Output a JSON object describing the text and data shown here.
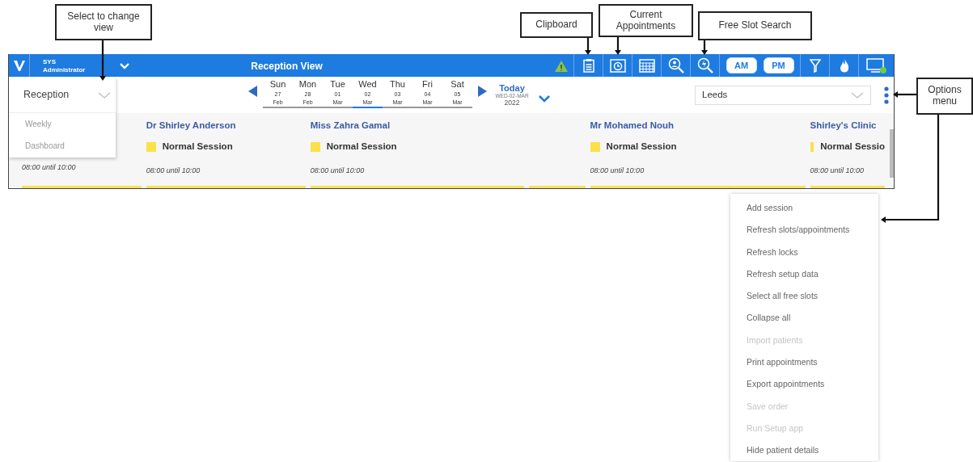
{
  "callouts": [
    {
      "text": "Select to change view"
    },
    {
      "text": "Clipboard"
    },
    {
      "text": "Current Appointments"
    },
    {
      "text": "Free Slot Search"
    },
    {
      "text": "Options menu"
    }
  ],
  "header": {
    "user": [
      "SYS",
      "Administrator"
    ],
    "title": "Reception View",
    "session_buttons": [
      {
        "label": "AM"
      },
      {
        "label": "PM"
      }
    ]
  },
  "view_select": {
    "value": "Reception",
    "options": [
      "Weekly",
      "Dashboard"
    ]
  },
  "days": [
    {
      "day": "Sun",
      "date": "27",
      "month": "Feb",
      "selected": false
    },
    {
      "day": "Mon",
      "date": "28",
      "month": "Feb",
      "selected": false
    },
    {
      "day": "Tue",
      "date": "01",
      "month": "Mar",
      "selected": false
    },
    {
      "day": "Wed",
      "date": "02",
      "month": "Mar",
      "selected": true
    },
    {
      "day": "Thu",
      "date": "03",
      "month": "Mar",
      "selected": false
    },
    {
      "day": "Fri",
      "date": "04",
      "month": "Mar",
      "selected": false
    },
    {
      "day": "Sat",
      "date": "05",
      "month": "Mar",
      "selected": false
    }
  ],
  "today": {
    "label": "Today",
    "date": "WED-02-MAR",
    "year": "2022"
  },
  "location_select": {
    "value": "Leeds"
  },
  "columns": [
    {
      "time": "08:00 until 10:00"
    },
    {
      "name": "Dr Shirley Anderson",
      "session": "Normal Session",
      "time": "08:00 until 10:00"
    },
    {
      "name": "Miss Zahra Gamal",
      "session": "Normal Session",
      "time": "08:00 until 10:00"
    },
    {},
    {
      "name": "Mr Mohamed Nouh",
      "session": "Normal Session",
      "time": "08:00 until 10:00"
    },
    {
      "name": "Shirley's Clinic",
      "session": "Normal Sessio",
      "time": "08:00 until 10:00"
    }
  ],
  "options_menu": [
    {
      "label": "Add session",
      "disabled": false
    },
    {
      "label": "Refresh slots/appointments",
      "disabled": false
    },
    {
      "label": "Refresh locks",
      "disabled": false
    },
    {
      "label": "Refresh setup data",
      "disabled": false
    },
    {
      "label": "Select all free slots",
      "disabled": false
    },
    {
      "label": "Collapse all",
      "disabled": false
    },
    {
      "label": "Import patients",
      "disabled": true
    },
    {
      "label": "Print appointments",
      "disabled": false
    },
    {
      "label": "Export appointments",
      "disabled": false
    },
    {
      "label": "Save order",
      "disabled": true
    },
    {
      "label": "Run Setup app",
      "disabled": true
    },
    {
      "label": "Hide patient details",
      "disabled": false
    }
  ]
}
